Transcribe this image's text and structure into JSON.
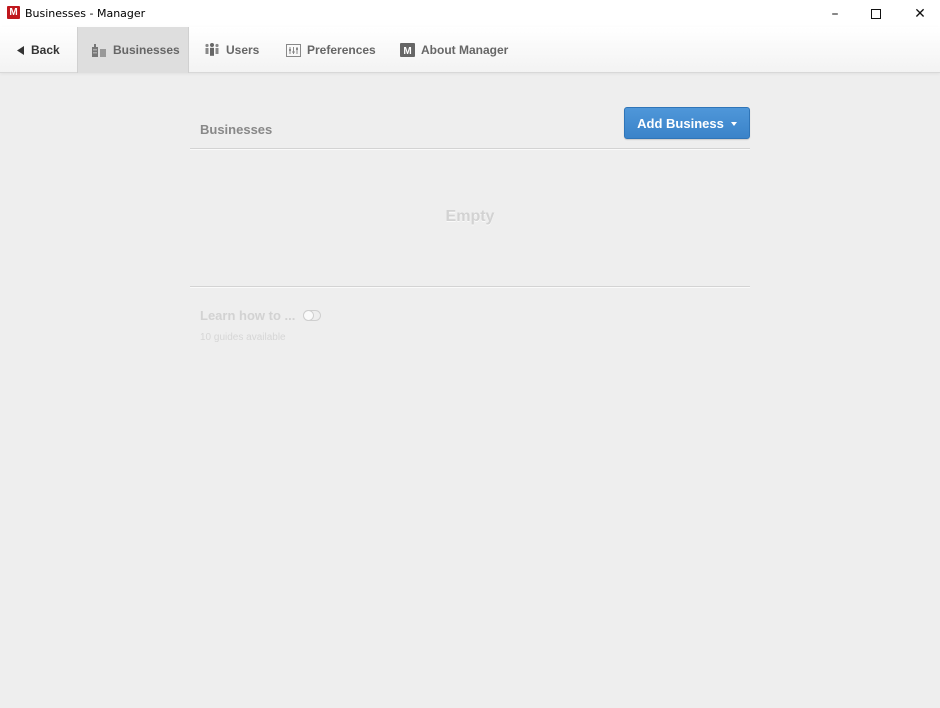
{
  "window": {
    "logo_letter": "M",
    "title": "Businesses - Manager",
    "controls": {
      "minimize": "–",
      "close": "✕"
    }
  },
  "tabs": [
    {
      "label": "Back",
      "icon": "back-arrow-icon"
    },
    {
      "label": "Businesses",
      "icon": "buildings-icon",
      "active": true
    },
    {
      "label": "Users",
      "icon": "users-icon"
    },
    {
      "label": "Preferences",
      "icon": "preferences-icon"
    },
    {
      "label": "About Manager",
      "icon": "manager-logo-icon"
    }
  ],
  "main": {
    "section_title": "Businesses",
    "add_button_label": "Add Business",
    "empty_label": "Empty",
    "learn": {
      "title": "Learn how to ...",
      "subtitle": "10 guides available"
    }
  },
  "colors": {
    "accent": "#4a90d9",
    "logo": "#c0171d",
    "background": "#eeeeee"
  }
}
